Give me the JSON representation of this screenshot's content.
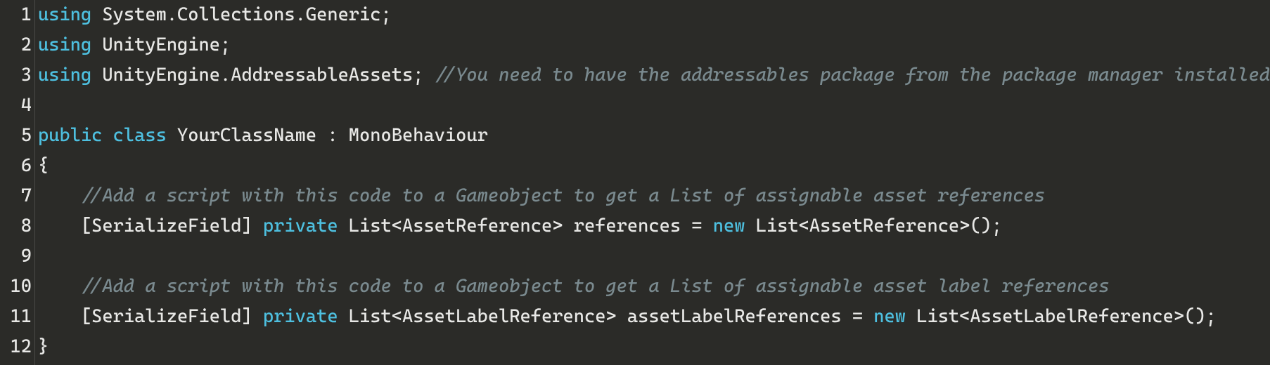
{
  "editor": {
    "language": "csharp",
    "colors": {
      "background": "#2b2b28",
      "foreground": "#e8e8e6",
      "keyword": "#4ec0e0",
      "comment": "#7a8a8f",
      "gutter_border": "#4a4a46"
    },
    "line_numbers": [
      "1",
      "2",
      "3",
      "4",
      "5",
      "6",
      "7",
      "8",
      "9",
      "10",
      "11",
      "12"
    ],
    "lines": [
      [
        {
          "t": "keyword",
          "v": "using"
        },
        {
          "t": "plain",
          "v": " System.Collections.Generic;"
        }
      ],
      [
        {
          "t": "keyword",
          "v": "using"
        },
        {
          "t": "plain",
          "v": " UnityEngine;"
        }
      ],
      [
        {
          "t": "keyword",
          "v": "using"
        },
        {
          "t": "plain",
          "v": " UnityEngine.AddressableAssets; "
        },
        {
          "t": "comment",
          "v": "//You need to have the addressables package from the package manager installed."
        }
      ],
      [
        {
          "t": "plain",
          "v": ""
        }
      ],
      [
        {
          "t": "keyword",
          "v": "public"
        },
        {
          "t": "plain",
          "v": " "
        },
        {
          "t": "keyword",
          "v": "class"
        },
        {
          "t": "plain",
          "v": " YourClassName : MonoBehaviour"
        }
      ],
      [
        {
          "t": "plain",
          "v": "{"
        }
      ],
      [
        {
          "t": "plain",
          "v": "    "
        },
        {
          "t": "comment",
          "v": "//Add a script with this code to a Gameobject to get a List of assignable asset references"
        }
      ],
      [
        {
          "t": "plain",
          "v": "    [SerializeField] "
        },
        {
          "t": "keyword",
          "v": "private"
        },
        {
          "t": "plain",
          "v": " List<AssetReference> references = "
        },
        {
          "t": "keyword",
          "v": "new"
        },
        {
          "t": "plain",
          "v": " List<AssetReference>();"
        }
      ],
      [
        {
          "t": "plain",
          "v": ""
        }
      ],
      [
        {
          "t": "plain",
          "v": "    "
        },
        {
          "t": "comment",
          "v": "//Add a script with this code to a Gameobject to get a List of assignable asset label references"
        }
      ],
      [
        {
          "t": "plain",
          "v": "    [SerializeField] "
        },
        {
          "t": "keyword",
          "v": "private"
        },
        {
          "t": "plain",
          "v": " List<AssetLabelReference> assetLabelReferences = "
        },
        {
          "t": "keyword",
          "v": "new"
        },
        {
          "t": "plain",
          "v": " List<AssetLabelReference>();"
        }
      ],
      [
        {
          "t": "plain",
          "v": "}"
        }
      ]
    ]
  }
}
